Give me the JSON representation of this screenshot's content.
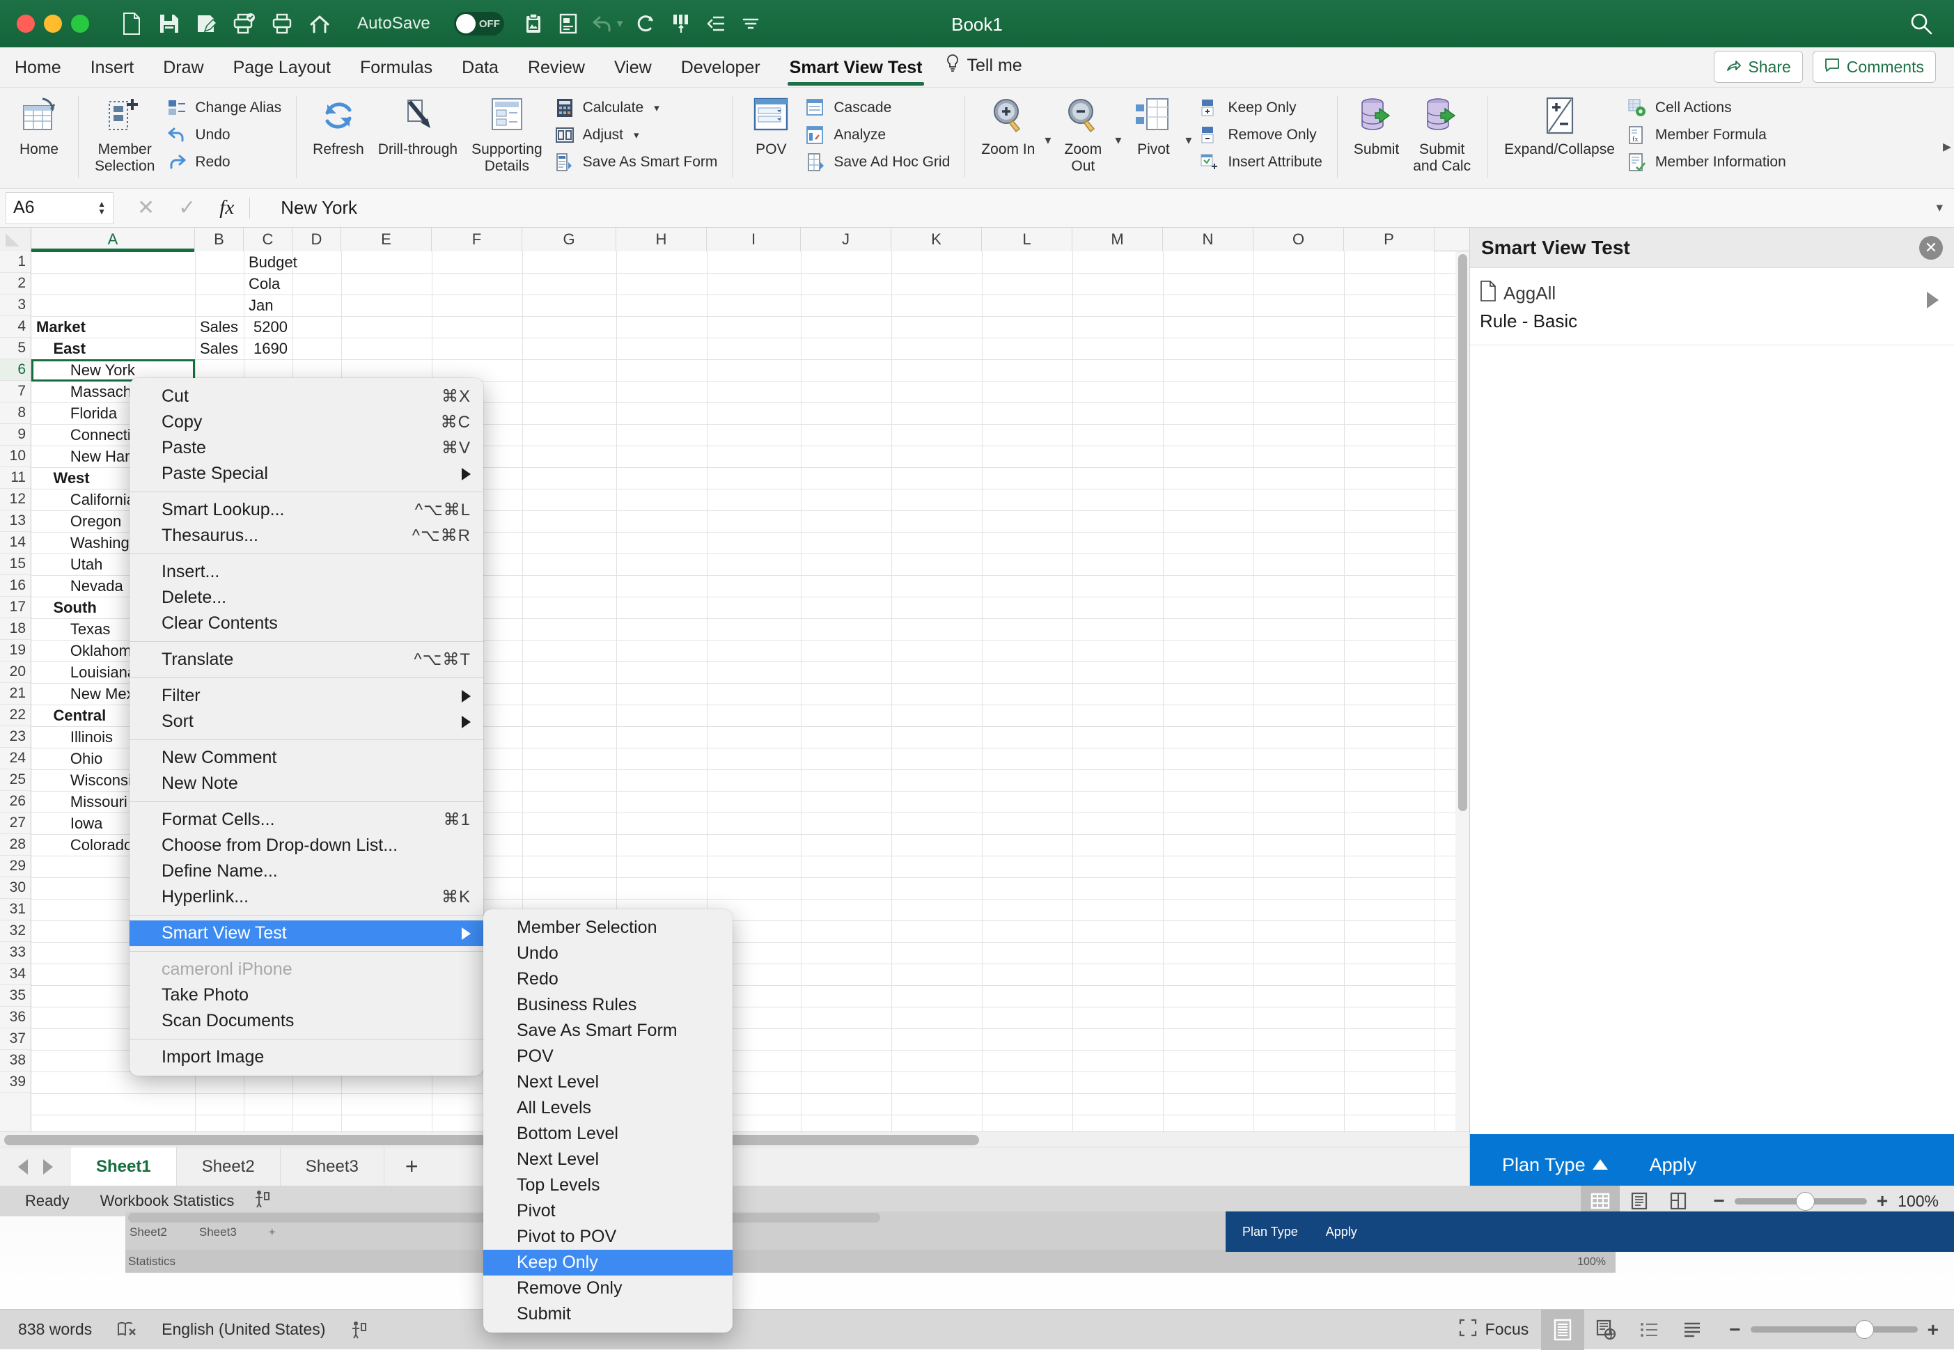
{
  "titlebar": {
    "window_title": "Book1",
    "autosave_label": "AutoSave",
    "autosave_state": "OFF",
    "icons": [
      "new-document-icon",
      "save-icon",
      "save-as-icon",
      "print-preview-icon",
      "print-icon",
      "home-icon",
      "paste-clipboard-icon",
      "form-icon",
      "undo-icon",
      "redo-icon",
      "columns-icon",
      "list-icon",
      "customize-toolbar-icon",
      "search-icon"
    ]
  },
  "ribbon_tabs": {
    "tabs": [
      "Home",
      "Insert",
      "Draw",
      "Page Layout",
      "Formulas",
      "Data",
      "Review",
      "View",
      "Developer",
      "Smart View Test"
    ],
    "active": "Smart View Test",
    "tell_me": "Tell me",
    "share": "Share",
    "comments": "Comments"
  },
  "ribbon": {
    "groups": [
      {
        "big": [
          {
            "label": "Home",
            "icon": "home-grid-icon"
          }
        ],
        "small": []
      },
      {
        "big": [
          {
            "label": "Member\nSelection",
            "icon": "member-selection-icon"
          }
        ],
        "small": [
          {
            "label": "Change Alias",
            "icon": "change-alias-icon",
            "caret": false
          },
          {
            "label": "Undo",
            "icon": "undo-arrow-icon",
            "caret": false
          },
          {
            "label": "Redo",
            "icon": "redo-arrow-icon",
            "caret": false
          }
        ]
      },
      {
        "big": [
          {
            "label": "Refresh",
            "icon": "refresh-icon"
          },
          {
            "label": "Drill-through",
            "icon": "drill-through-icon"
          },
          {
            "label": "Supporting\nDetails",
            "icon": "supporting-details-icon"
          }
        ],
        "small": [
          {
            "label": "Calculate",
            "icon": "calculator-icon",
            "caret": true
          },
          {
            "label": "Adjust",
            "icon": "adjust-icon",
            "caret": true
          },
          {
            "label": "Save As Smart Form",
            "icon": "smart-form-icon",
            "caret": false
          }
        ]
      },
      {
        "big": [
          {
            "label": "POV",
            "icon": "pov-icon"
          }
        ],
        "small": [
          {
            "label": "Cascade",
            "icon": "cascade-icon",
            "caret": false
          },
          {
            "label": "Analyze",
            "icon": "analyze-icon",
            "caret": false
          },
          {
            "label": "Save Ad Hoc Grid",
            "icon": "save-adhoc-icon",
            "caret": false
          }
        ]
      },
      {
        "big": [
          {
            "label": "Zoom In",
            "icon": "zoom-in-icon",
            "caret": true
          },
          {
            "label": "Zoom\nOut",
            "icon": "zoom-out-icon",
            "caret": true
          },
          {
            "label": "Pivot",
            "icon": "pivot-icon",
            "caret": true
          }
        ],
        "small": [
          {
            "label": "Keep Only",
            "icon": "keep-only-icon",
            "caret": false
          },
          {
            "label": "Remove Only",
            "icon": "remove-only-icon",
            "caret": false
          },
          {
            "label": "Insert Attribute",
            "icon": "insert-attribute-icon",
            "caret": false
          }
        ]
      },
      {
        "big": [
          {
            "label": "Submit",
            "icon": "submit-icon"
          },
          {
            "label": "Submit\nand Calc",
            "icon": "submit-calc-icon"
          }
        ],
        "small": []
      },
      {
        "big": [
          {
            "label": "Expand/Collapse",
            "icon": "expand-collapse-icon"
          }
        ],
        "small": [
          {
            "label": "Cell Actions",
            "icon": "cell-actions-icon",
            "caret": false
          },
          {
            "label": "Member Formula",
            "icon": "member-formula-icon",
            "caret": false
          },
          {
            "label": "Member Information",
            "icon": "member-information-icon",
            "caret": false
          }
        ]
      }
    ]
  },
  "formula_bar": {
    "name_box": "A6",
    "value": "New York",
    "cancel_icon": "cancel-icon",
    "accept_icon": "accept-icon",
    "fx_icon": "fx-icon"
  },
  "grid": {
    "columns": [
      "A",
      "B",
      "C",
      "D",
      "E",
      "F",
      "G",
      "H",
      "I",
      "J",
      "K",
      "L",
      "M",
      "N",
      "O",
      "P"
    ],
    "selected_column": "A",
    "selected_row": 6,
    "selected_cell": "A6",
    "row_count": 39,
    "rows": [
      {
        "n": 1,
        "A": "",
        "B": "",
        "C": "Budget"
      },
      {
        "n": 2,
        "A": "",
        "B": "",
        "C": "Cola"
      },
      {
        "n": 3,
        "A": "",
        "B": "",
        "C": "Jan"
      },
      {
        "n": 4,
        "A": "Market",
        "B": "Sales",
        "C": "5200"
      },
      {
        "n": 5,
        "A": "  East",
        "B": "Sales",
        "C": "1690"
      },
      {
        "n": 6,
        "A": "    New York",
        "B": "",
        "C": ""
      },
      {
        "n": 7,
        "A": "    Massachusetts",
        "B": "",
        "C": ""
      },
      {
        "n": 8,
        "A": "    Florida",
        "B": "",
        "C": ""
      },
      {
        "n": 9,
        "A": "    Connecticut",
        "B": "",
        "C": ""
      },
      {
        "n": 10,
        "A": "    New Hampshire",
        "B": "",
        "C": ""
      },
      {
        "n": 11,
        "A": "  West",
        "B": "",
        "C": ""
      },
      {
        "n": 12,
        "A": "    California",
        "B": "",
        "C": ""
      },
      {
        "n": 13,
        "A": "    Oregon",
        "B": "",
        "C": ""
      },
      {
        "n": 14,
        "A": "    Washington",
        "B": "",
        "C": ""
      },
      {
        "n": 15,
        "A": "    Utah",
        "B": "",
        "C": ""
      },
      {
        "n": 16,
        "A": "    Nevada",
        "B": "",
        "C": ""
      },
      {
        "n": 17,
        "A": "  South",
        "B": "",
        "C": ""
      },
      {
        "n": 18,
        "A": "    Texas",
        "B": "",
        "C": ""
      },
      {
        "n": 19,
        "A": "    Oklahoma",
        "B": "",
        "C": ""
      },
      {
        "n": 20,
        "A": "    Louisiana",
        "B": "",
        "C": ""
      },
      {
        "n": 21,
        "A": "    New Mexico",
        "B": "",
        "C": ""
      },
      {
        "n": 22,
        "A": "  Central",
        "B": "",
        "C": ""
      },
      {
        "n": 23,
        "A": "    Illinois",
        "B": "",
        "C": ""
      },
      {
        "n": 24,
        "A": "    Ohio",
        "B": "",
        "C": ""
      },
      {
        "n": 25,
        "A": "    Wisconsin",
        "B": "",
        "C": ""
      },
      {
        "n": 26,
        "A": "    Missouri",
        "B": "",
        "C": ""
      },
      {
        "n": 27,
        "A": "    Iowa",
        "B": "",
        "C": ""
      },
      {
        "n": 28,
        "A": "    Colorado",
        "B": "",
        "C": ""
      }
    ]
  },
  "side_panel": {
    "title": "Smart View Test",
    "close_icon": "close-icon",
    "item": {
      "doc_icon": "document-icon",
      "name": "AggAll",
      "subtitle": "Rule - Basic",
      "expand_icon": "chevron-right-icon"
    },
    "footer": {
      "plan_type": "Plan Type",
      "apply": "Apply"
    }
  },
  "sheet_tabs": {
    "tabs": [
      "Sheet1",
      "Sheet2",
      "Sheet3"
    ],
    "active": "Sheet1",
    "add_label": "+"
  },
  "status_bar": {
    "ready": "Ready",
    "workbook_statistics": "Workbook Statistics",
    "accessibility_icon": "accessibility-icon",
    "view_normal_icon": "normal-view-icon",
    "view_page_layout_icon": "page-layout-view-icon",
    "view_page_break_icon": "page-break-view-icon",
    "zoom_minus": "−",
    "zoom_plus": "+",
    "zoom_pct": "100%"
  },
  "background_window": {
    "word_count": "838 words",
    "proofing_icon": "proofing-icon",
    "language": "English (United States)",
    "accessibility_icon": "accessibility-icon",
    "focus": "Focus",
    "icons": [
      "focus-icon",
      "print-layout-icon",
      "web-layout-icon",
      "outline-icon",
      "draft-icon"
    ],
    "ghost_sheet_tabs": [
      "Sheet2",
      "Sheet3",
      "+"
    ],
    "ghost_statistics": "Statistics",
    "ghost_plan_type": "Plan Type",
    "ghost_apply": "Apply",
    "ghost_zoom_pct": "100%"
  },
  "context_menu": {
    "items": [
      {
        "label": "Cut",
        "shortcut": "⌘X",
        "type": "item"
      },
      {
        "label": "Copy",
        "shortcut": "⌘C",
        "type": "item"
      },
      {
        "label": "Paste",
        "shortcut": "⌘V",
        "type": "item"
      },
      {
        "label": "Paste Special",
        "shortcut": "",
        "type": "submenu"
      },
      {
        "type": "separator"
      },
      {
        "label": "Smart Lookup...",
        "shortcut": "^⌥⌘L",
        "type": "item"
      },
      {
        "label": "Thesaurus...",
        "shortcut": "^⌥⌘R",
        "type": "item"
      },
      {
        "type": "separator"
      },
      {
        "label": "Insert...",
        "shortcut": "",
        "type": "item"
      },
      {
        "label": "Delete...",
        "shortcut": "",
        "type": "item"
      },
      {
        "label": "Clear Contents",
        "shortcut": "",
        "type": "item"
      },
      {
        "type": "separator"
      },
      {
        "label": "Translate",
        "shortcut": "^⌥⌘T",
        "type": "item"
      },
      {
        "type": "separator"
      },
      {
        "label": "Filter",
        "shortcut": "",
        "type": "submenu"
      },
      {
        "label": "Sort",
        "shortcut": "",
        "type": "submenu"
      },
      {
        "type": "separator"
      },
      {
        "label": "New Comment",
        "shortcut": "",
        "type": "item"
      },
      {
        "label": "New Note",
        "shortcut": "",
        "type": "item"
      },
      {
        "type": "separator"
      },
      {
        "label": "Format Cells...",
        "shortcut": "⌘1",
        "type": "item"
      },
      {
        "label": "Choose from Drop-down List...",
        "shortcut": "",
        "type": "item"
      },
      {
        "label": "Define Name...",
        "shortcut": "",
        "type": "item"
      },
      {
        "label": "Hyperlink...",
        "shortcut": "⌘K",
        "type": "item"
      },
      {
        "type": "separator"
      },
      {
        "label": "Smart View Test",
        "shortcut": "",
        "type": "submenu",
        "selected": true
      },
      {
        "type": "separator"
      },
      {
        "label": "cameronl iPhone",
        "shortcut": "",
        "type": "disabled"
      },
      {
        "label": "Take Photo",
        "shortcut": "",
        "type": "item"
      },
      {
        "label": "Scan Documents",
        "shortcut": "",
        "type": "item"
      },
      {
        "type": "separator"
      },
      {
        "label": "Import Image",
        "shortcut": "",
        "type": "item"
      }
    ]
  },
  "context_submenu": {
    "items": [
      {
        "label": "Member Selection"
      },
      {
        "label": "Undo"
      },
      {
        "label": "Redo"
      },
      {
        "label": "Business Rules"
      },
      {
        "label": "Save As Smart Form"
      },
      {
        "label": "POV"
      },
      {
        "label": "Next Level"
      },
      {
        "label": "All Levels"
      },
      {
        "label": "Bottom Level"
      },
      {
        "label": "Next Level"
      },
      {
        "label": "Top Levels"
      },
      {
        "label": "Pivot"
      },
      {
        "label": "Pivot to POV"
      },
      {
        "label": "Keep Only",
        "selected": true
      },
      {
        "label": "Remove Only"
      },
      {
        "label": "Submit"
      }
    ]
  },
  "colors": {
    "titlebar_green": "#186a3f",
    "accent_green": "#156e3f",
    "menu_highlight": "#3d8bf2",
    "panel_footer_blue": "#0576d3"
  }
}
